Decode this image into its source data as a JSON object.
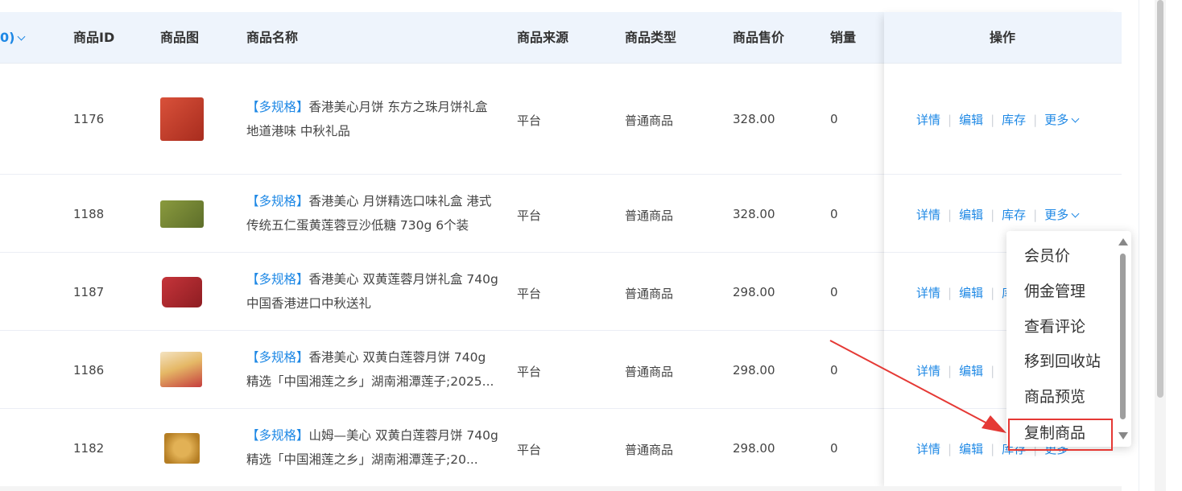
{
  "header": {
    "partial_col": "0)",
    "columns": [
      "商品ID",
      "商品图",
      "商品名称",
      "商品来源",
      "商品类型",
      "商品售价",
      "销量",
      "操作"
    ]
  },
  "rows": [
    {
      "id": "1176",
      "tag": "【多规格】",
      "name": "香港美心月饼 东方之珠月饼礼盒 地道港味 中秋礼品",
      "source": "平台",
      "type": "普通商品",
      "price": "328.00",
      "sales": "0",
      "thumb_color": "#c9412a"
    },
    {
      "id": "1188",
      "tag": "【多规格】",
      "name": "香港美心 月饼精选口味礼盒 港式传统五仁蛋黄莲蓉豆沙低糖 730g 6个装",
      "source": "平台",
      "type": "普通商品",
      "price": "328.00",
      "sales": "0",
      "thumb_color": "#7a8a3c"
    },
    {
      "id": "1187",
      "tag": "【多规格】",
      "name": "香港美心 双黄莲蓉月饼礼盒 740g 中国香港进口中秋送礼",
      "source": "平台",
      "type": "普通商品",
      "price": "298.00",
      "sales": "0",
      "thumb_color": "#b3282d"
    },
    {
      "id": "1186",
      "tag": "【多规格】",
      "name": "香港美心 双黄白莲蓉月饼 740g 精选「中国湘莲之乡」湖南湘潭莲子;2025...",
      "source": "平台",
      "type": "普通商品",
      "price": "298.00",
      "sales": "0",
      "thumb_color": "#d8a24a"
    },
    {
      "id": "1182",
      "tag": "【多规格】",
      "name": "山姆—美心 双黄白莲蓉月饼 740g 精选「中国湘莲之乡」湖南湘潭莲子;20...",
      "source": "平台",
      "type": "普通商品",
      "price": "298.00",
      "sales": "0",
      "thumb_color": "#c8902e"
    }
  ],
  "ops": {
    "detail": "详情",
    "edit": "编辑",
    "stock": "库存",
    "more": "更多"
  },
  "dropdown": {
    "items": [
      "会员价",
      "佣金管理",
      "查看评论",
      "移到回收站",
      "商品预览",
      "复制商品"
    ],
    "highlighted": "复制商品"
  },
  "colors": {
    "link": "#1e88e5",
    "header_bg": "#eef4fc",
    "annotation": "#e53935"
  }
}
